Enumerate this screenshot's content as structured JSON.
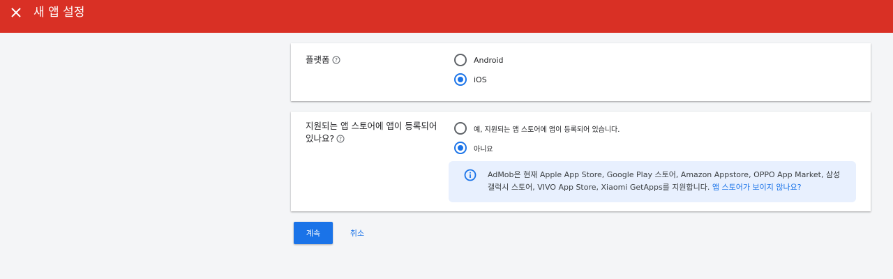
{
  "header": {
    "title": "새 앱 설정",
    "close_icon": "close-icon",
    "bg_color": "#d93025"
  },
  "platform": {
    "label": "플랫폼",
    "options": [
      {
        "label": "Android",
        "selected": false
      },
      {
        "label": "iOS",
        "selected": true
      }
    ]
  },
  "store": {
    "label_line1": "지원되는 앱 스토어에 앱이 등록되어",
    "label_line2": "있나요?",
    "options": [
      {
        "label": "예, 지원되는 앱 스토어에 앱이 등록되어 있습니다.",
        "selected": false
      },
      {
        "label": "아니요",
        "selected": true
      }
    ],
    "info": {
      "text": "AdMob은 현재 Apple App Store, Google Play 스토어, Amazon Appstore, OPPO App Market, 삼성 갤럭시 스토어, VIVO App Store, Xiaomi GetApps를 지원합니다. ",
      "link": "앱 스토어가 보이지 않나요?"
    }
  },
  "actions": {
    "continue_label": "계속",
    "cancel_label": "취소"
  },
  "colors": {
    "accent": "#1a73e8",
    "info_bg": "#e8f0fe"
  }
}
